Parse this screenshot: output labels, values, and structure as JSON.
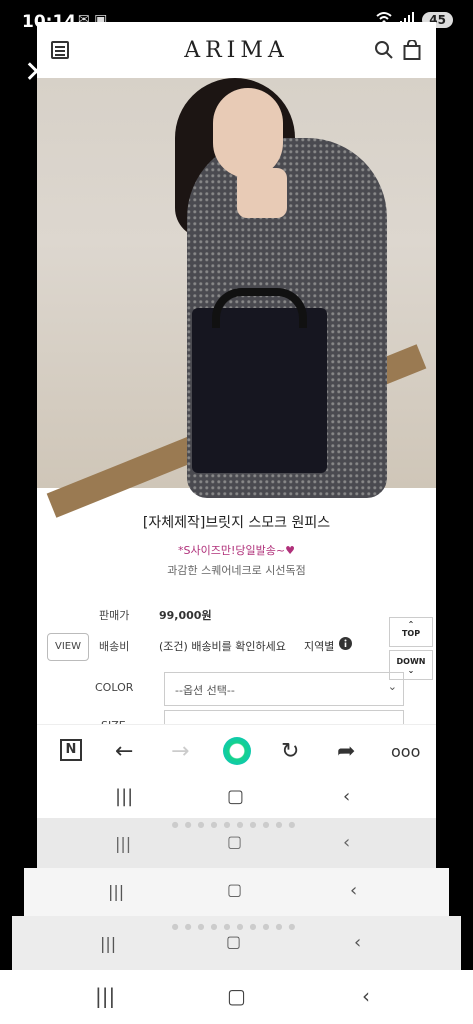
{
  "status": {
    "time": "10:14",
    "battery": "45",
    "notif_icons": "✉ ▣"
  },
  "site": {
    "logo": "ARIMA"
  },
  "product": {
    "title": "[자체제작]브릿지 스모크 원피스",
    "badge": "*S사이즈만!당일발송~♥",
    "desc": "과감한 스퀘어네크로 시선독점",
    "price_label": "판매가",
    "price": "99,000원",
    "shipping_label": "배송비",
    "shipping_value": "(조건) 배송비를 확인하세요",
    "region_label": "지역별",
    "color_label": "COLOR",
    "color_select": "--옵션 선택--",
    "size_label": "SIZE",
    "view_button": "VIEW",
    "top_button": "TOP",
    "down_button": "DOWN"
  },
  "icons": {
    "menu": "menu-icon",
    "search": "search-icon",
    "bag": "shopping-bag-icon",
    "back": "back-arrow-icon",
    "forward": "forward-arrow-icon",
    "refresh": "refresh-icon",
    "share": "share-icon",
    "more": "more-icon"
  }
}
